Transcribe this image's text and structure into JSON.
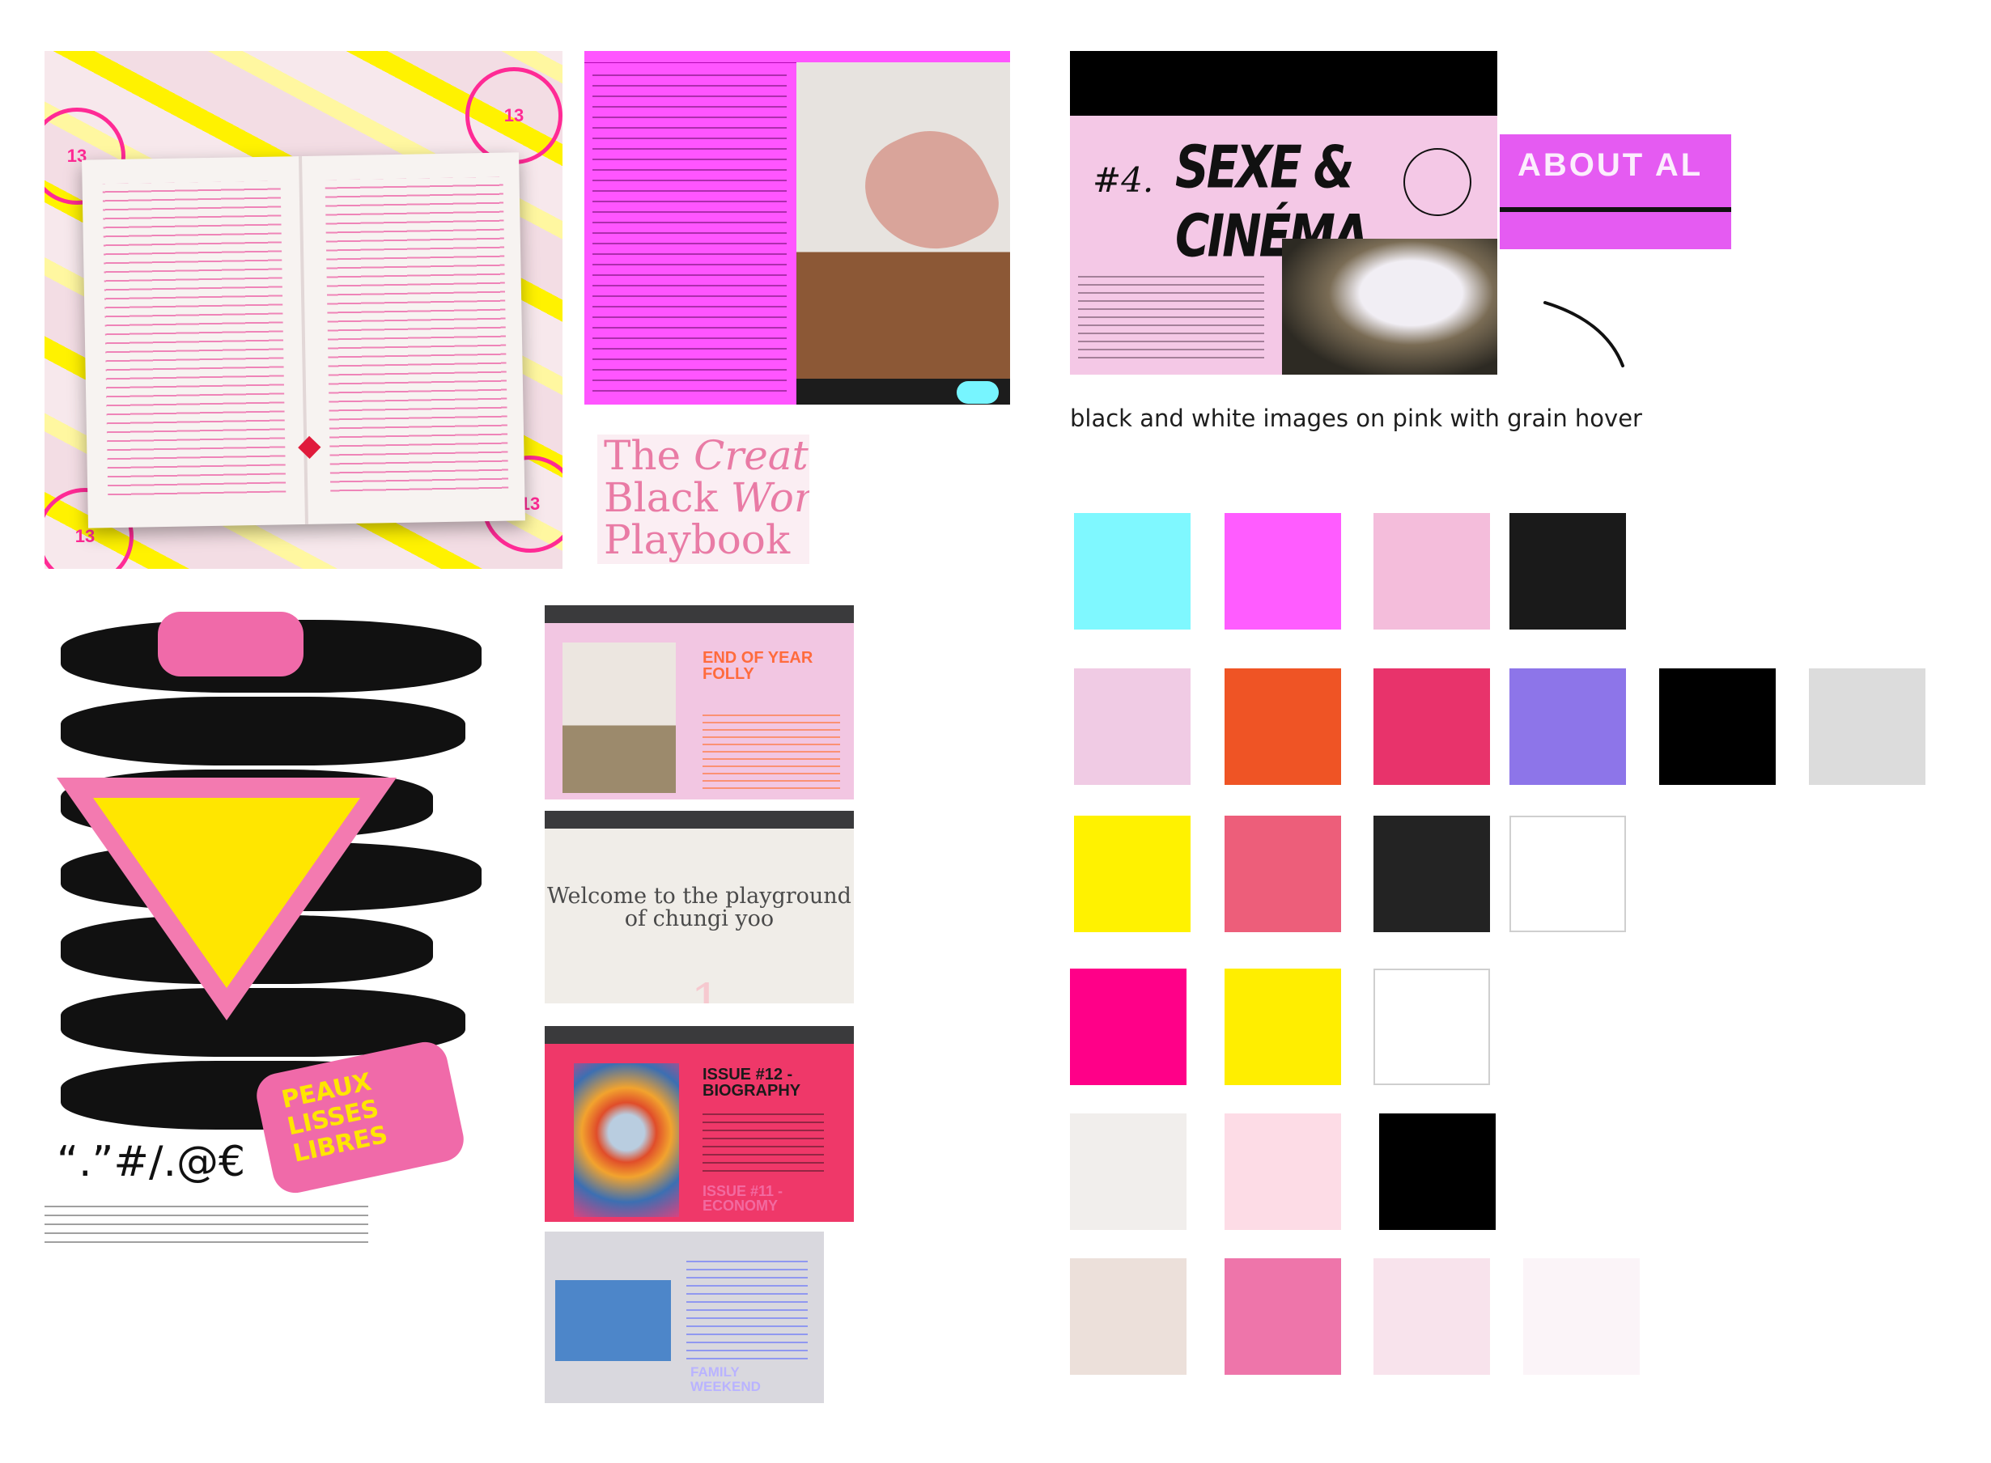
{
  "caption": "black and white images on pink with grain hover",
  "cinema": {
    "number": "#4.",
    "title": "SEXE & CINÉMA"
  },
  "about": {
    "label": "ABOUT AL"
  },
  "playbook": {
    "line1": "The",
    "line1_italic": "Creati",
    "line2": "Black",
    "line2_italic": "Wom",
    "line3": "Playbook"
  },
  "poster": {
    "peaux_lines": [
      "PEAUX",
      "LISSES",
      "LIBRES"
    ],
    "glyph_row": "“.”#/.@€"
  },
  "folly": {
    "heading": "END OF YEAR FOLLY"
  },
  "chung": {
    "welcome": "Welcome to the playground of chungi yoo"
  },
  "issue": {
    "heading": "ISSUE #12 - BIOGRAPHY",
    "subheading": "ISSUE #11 - ECONOMY"
  },
  "family": {
    "subheading": "FAMILY WEEKEND"
  },
  "swatch_rows": [
    [
      "#7ff8ff",
      "#ff5cff",
      "#f4bddb",
      "#1a1a1a"
    ],
    [
      "#f0cbe4",
      "#ef5425",
      "#e8336b",
      "#8d75e9",
      "#000000",
      "#dcdcdc"
    ],
    [
      "#fff200",
      "#ed5e7a",
      "#232323",
      "#ffffff"
    ],
    [
      "#ff0088",
      "#ffee00",
      "#ffffff"
    ],
    [
      "#f1eeec",
      "#fddce6",
      "#000000"
    ],
    [
      "#ece0da",
      "#ee75aa",
      "#f8e3ec",
      "#fbf4f8"
    ]
  ]
}
